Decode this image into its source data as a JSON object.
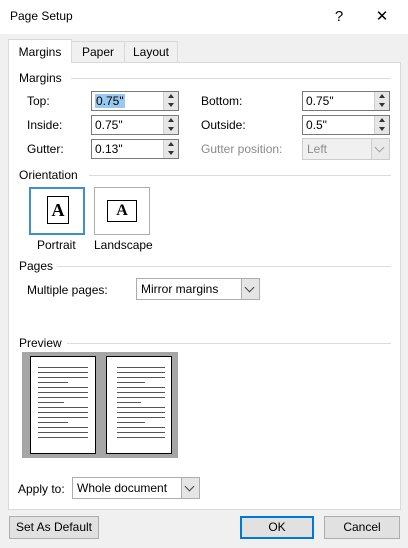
{
  "window": {
    "title": "Page Setup",
    "help": "?",
    "close": "✕"
  },
  "tabs": [
    {
      "label": "Margins"
    },
    {
      "label": "Paper"
    },
    {
      "label": "Layout"
    }
  ],
  "margins": {
    "heading": "Margins",
    "top": {
      "label": "Top:",
      "value": "0.75\""
    },
    "bottom": {
      "label": "Bottom:",
      "value": "0.75\""
    },
    "inside": {
      "label": "Inside:",
      "value": "0.75\""
    },
    "outside": {
      "label": "Outside:",
      "value": "0.5\""
    },
    "gutter": {
      "label": "Gutter:",
      "value": "0.13\""
    },
    "gutter_position": {
      "label": "Gutter position:",
      "value": "Left"
    }
  },
  "orientation": {
    "heading": "Orientation",
    "portrait": {
      "label": "Portrait",
      "glyph": "A"
    },
    "landscape": {
      "label": "Landscape",
      "glyph": "A"
    }
  },
  "pages": {
    "heading": "Pages",
    "multiple_pages_label": "Multiple pages:",
    "multiple_pages_value": "Mirror margins"
  },
  "preview": {
    "heading": "Preview"
  },
  "apply": {
    "label": "Apply to:",
    "value": "Whole document"
  },
  "buttons": {
    "set_default": "Set As Default",
    "ok": "OK",
    "cancel": "Cancel"
  },
  "colors": {
    "accent": "#0078d7",
    "selection": "#99c9ef"
  }
}
